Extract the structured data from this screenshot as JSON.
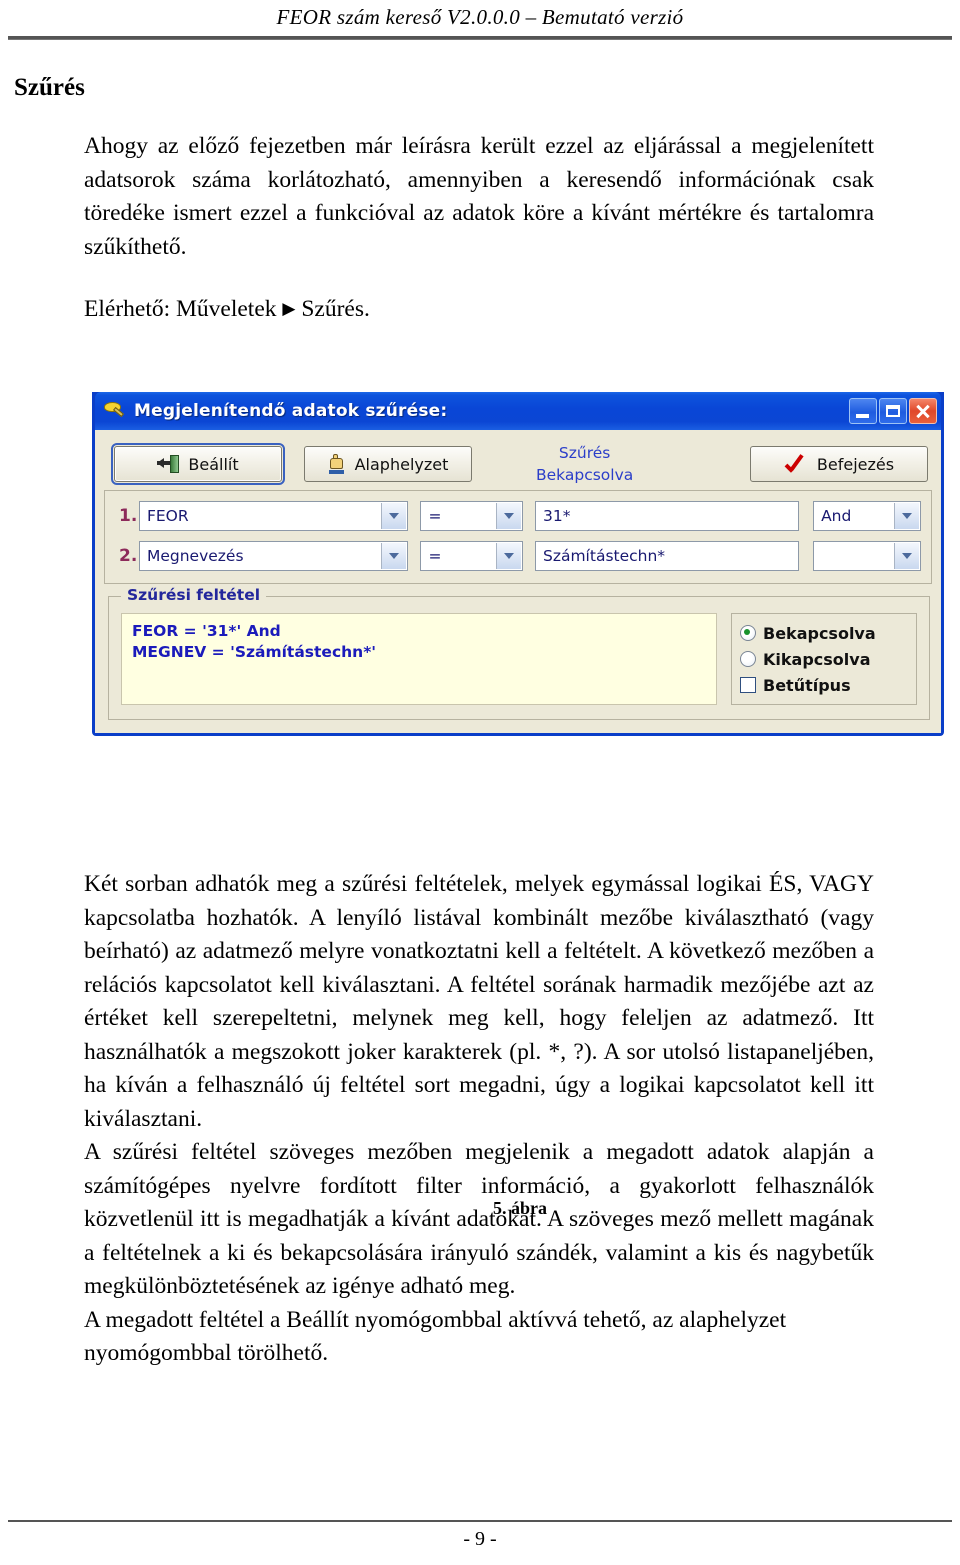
{
  "page": {
    "header": "FEOR szám kereső V2.0.0.0 – Bemutató verzió",
    "section_title": "Szűrés",
    "footer": "- 9 -"
  },
  "content": {
    "intro_paragraph": "Ahogy az előző fejezetben már leírásra került ezzel az eljárással a megjelenített adatsorok száma korlátozható, amennyiben a keresendő információnak csak töredéke ismert ezzel a funkcióval az adatok köre a kívánt mértékre és tartalomra szűkíthető.",
    "availability_prefix": "Elérhető: Műveletek",
    "availability_arrow": "▶",
    "availability_suffix": "Szűrés.",
    "figure_caption": "5. ábra",
    "paragraph_2": "Két sorban adhatók meg a szűrési feltételek, melyek egymással logikai ÉS, VAGY kapcsolatba hozhatók. A lenyíló listával kombinált mezőbe kiválasztható (vagy beírható) az adatmező melyre vonatkoztatni kell a feltételt. A következő mezőben a relációs kapcsolatot kell kiválasztani. A feltétel sorának harmadik mezőjébe azt az értéket kell szerepeltetni, melynek meg kell, hogy feleljen az adatmező. Itt használhatók a megszokott joker karakterek (pl. *, ?). A sor utolsó listapaneljében, ha kíván a felhasználó új feltétel sort megadni, úgy a logikai kapcsolatot kell itt kiválasztani.",
    "paragraph_3": "A szűrési feltétel szöveges mezőben megjelenik a megadott adatok alapján a számítógépes nyelvre fordított filter információ, a gyakorlott felhasználók közvetlenül itt is megadhatják a kívánt adatokat. A szöveges mező mellett magának a feltételnek a ki és bekapcsolására irányuló szándék, valamint a kis és nagybetűk megkülönböztetésének az igénye adható meg.",
    "paragraph_4": "A megadott feltétel a Beállít nyomógombbal aktívvá tehető, az alaphelyzet nyomógombbal törölhető."
  },
  "dialog": {
    "title": "Megjelenítendő adatok szűrése:",
    "title_icon": "filter-funnel-icon",
    "window_buttons": {
      "minimize": "minimize-icon",
      "maximize": "maximize-icon",
      "close": "close-icon"
    },
    "toolbar": {
      "apply_label": "Beállít",
      "apply_icon": "apply-arrow-icon",
      "reset_label": "Alaphelyzet",
      "reset_icon": "hand-pointer-icon",
      "status_line1": "Szűrés",
      "status_line2": "Bekapcsolva",
      "finish_label": "Befejezés",
      "finish_icon": "red-check-icon"
    },
    "filter_rows": [
      {
        "number": "1.",
        "field": "FEOR",
        "operator": "=",
        "value": "31*",
        "link": "And"
      },
      {
        "number": "2.",
        "field": "Megnevezés",
        "operator": "=",
        "value": "Számítástechn*",
        "link": ""
      }
    ],
    "group": {
      "legend": "Szűrési feltétel",
      "condition_text": "FEOR = '31*' And\nMEGNEV = 'Számítástechn*'",
      "options": {
        "enabled_label": "Bekapcsolva",
        "disabled_label": "Kikapcsolva",
        "font_label": "Betűtípus",
        "enabled_selected": true,
        "font_checked": false
      }
    }
  },
  "colors": {
    "titlebar_blue": "#0a46d6",
    "dialog_face": "#ece9d8",
    "condition_text": "#1b1bbb",
    "condition_bg": "#ffffe1",
    "row_number": "#8d2a5a",
    "status_blue": "#2b3ec9",
    "legend_blue": "#23279c",
    "radio_dot_green": "#17922b",
    "close_red": "#e0482a"
  }
}
